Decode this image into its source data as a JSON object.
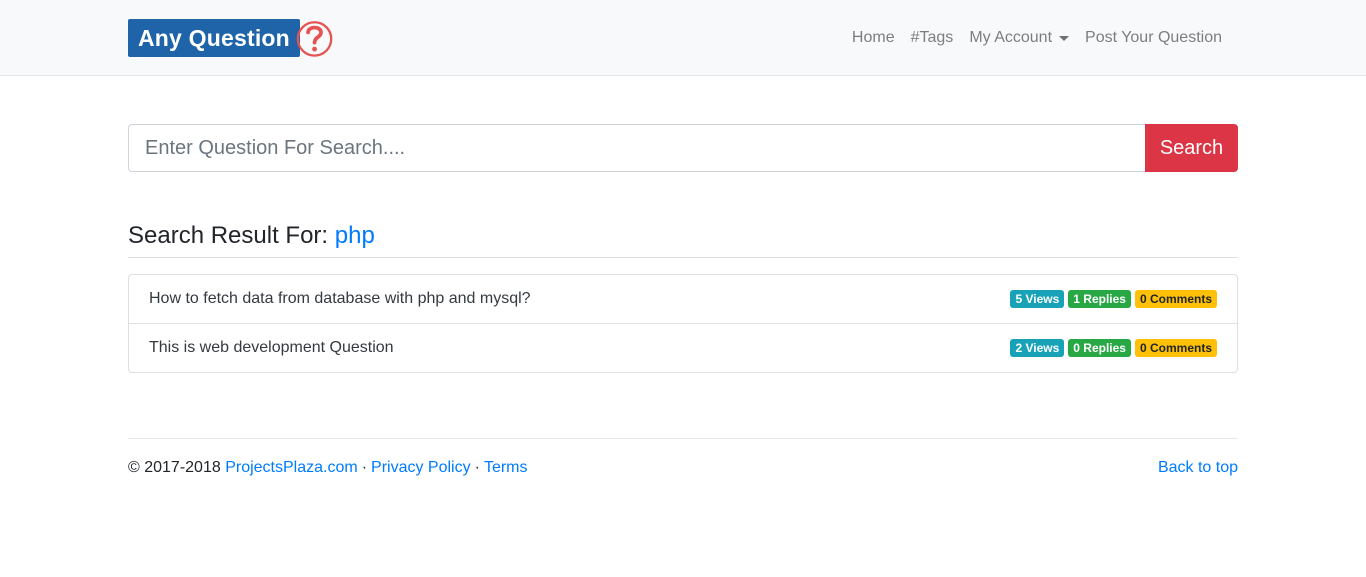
{
  "brand": {
    "text": "Any Question",
    "icon": "question-mark-icon",
    "color": "#1f64a8",
    "icon_color": "#e55353"
  },
  "nav": {
    "home": "Home",
    "tags": "#Tags",
    "account": "My Account",
    "post": "Post Your Question"
  },
  "search": {
    "placeholder": "Enter Question For Search....",
    "value": "",
    "button": "Search",
    "button_color": "#dc3545"
  },
  "results": {
    "heading_prefix": "Search Result For:",
    "term": "php",
    "items": [
      {
        "title": "How to fetch data from database with php and mysql?",
        "views": "5 Views",
        "replies": "1 Replies",
        "comments": "0 Comments"
      },
      {
        "title": "This is web development Question",
        "views": "2 Views",
        "replies": "0 Replies",
        "comments": "0 Comments"
      }
    ]
  },
  "footer": {
    "copyright": "© 2017-2018",
    "site_link": "ProjectsPlaza.com",
    "dot1": "·",
    "privacy": "Privacy Policy",
    "dot2": "·",
    "terms": "Terms",
    "back_to_top": "Back to top"
  }
}
